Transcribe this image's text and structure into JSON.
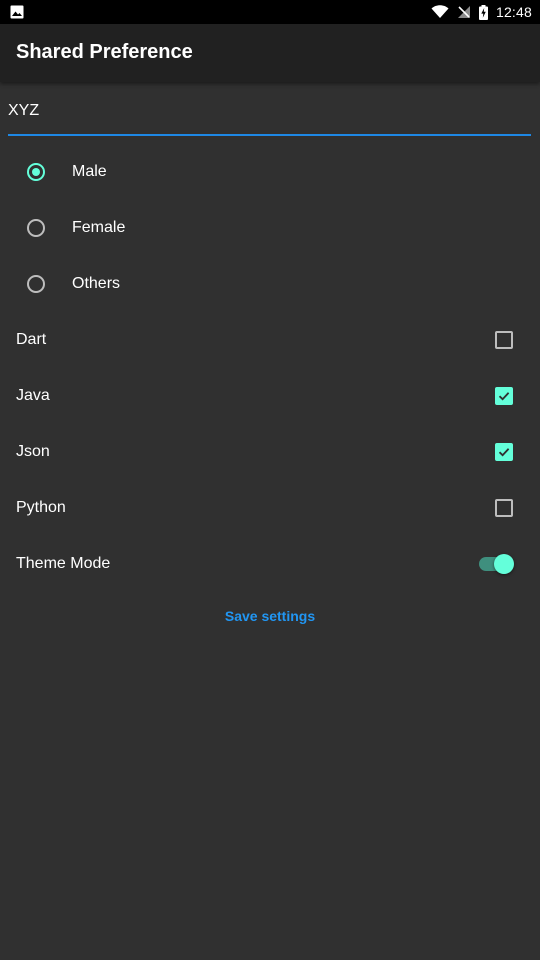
{
  "status_bar": {
    "time": "12:48",
    "icons": [
      "image-icon",
      "wifi-icon",
      "no-signal-icon",
      "battery-charging-icon"
    ]
  },
  "app_bar": {
    "title": "Shared Preference"
  },
  "text_field": {
    "value": "XYZ"
  },
  "gender_options": [
    {
      "label": "Male",
      "selected": true
    },
    {
      "label": "Female",
      "selected": false
    },
    {
      "label": "Others",
      "selected": false
    }
  ],
  "languages": [
    {
      "label": "Dart",
      "checked": false
    },
    {
      "label": "Java",
      "checked": true
    },
    {
      "label": "Json",
      "checked": true
    },
    {
      "label": "Python",
      "checked": false
    }
  ],
  "theme_mode": {
    "label": "Theme Mode",
    "enabled": true
  },
  "save_button": {
    "label": "Save settings"
  },
  "colors": {
    "accent": "#64ffda",
    "primary_blue": "#2196f3",
    "background": "#303030",
    "app_bar": "#212121"
  }
}
